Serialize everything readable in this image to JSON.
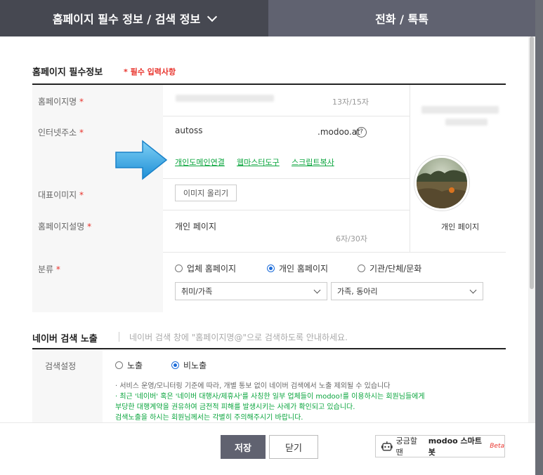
{
  "tabs": {
    "info_label": "홈페이지 필수 정보 / 검색 정보",
    "phone_label": "전화 / 톡톡"
  },
  "section1": {
    "title": "홈페이지 필수정보",
    "required_note": "* 필수 입력사항"
  },
  "rows": {
    "homepage_name": {
      "label": "홈페이지명",
      "count": "13자/15자"
    },
    "internet_address": {
      "label": "인터넷주소",
      "value": "autoss",
      "domain": ".modoo.at",
      "help": "?",
      "links": [
        "개인도메인연결",
        "웹마스터도구",
        "스크립트복사"
      ]
    },
    "rep_image": {
      "label": "대표이미지",
      "button": "이미지 올리기"
    },
    "description": {
      "label": "홈페이지설명",
      "value": "개인 페이지",
      "count": "6자/30자"
    },
    "category": {
      "label": "분류",
      "radios": [
        "업체 홈페이지",
        "개인 홈페이지",
        "기관/단체/문화"
      ],
      "selected_radio": 1,
      "select1": "취미/가족",
      "select2": "가족, 동아리"
    }
  },
  "required_star": "*",
  "preview": {
    "caption": "개인 페이지"
  },
  "section2": {
    "title": "네이버 검색 노출",
    "hint": "네이버 검색 창에 \"홈페이지명@\"으로 검색하도록 안내하세요.",
    "search_label": "검색설정",
    "radios": [
      "노출",
      "비노출"
    ],
    "selected_radio": 1,
    "notes": [
      "· 서비스 운영/모니터링 기준에 따라, 개별 통보 없이 네이버 검색에서 노출 제외될 수 있습니다",
      "· 최근 '네이버' 혹은 '네이버 대행사/제휴사'를 사칭한 일부 업체들이 modoo!를 이용하시는 회원님들에게",
      "  부당한 대행계약을 권유하여 금전적 피해를 발생시키는 사례가 확인되고 있습니다.",
      "  검색노출을 하시는 회원님께서는 각별히 주의해주시기 바랍니다."
    ]
  },
  "footer": {
    "save": "저장",
    "close": "닫기",
    "bot_prefix": "궁금할 땐",
    "bot_name": "modoo 스마트봇",
    "bot_beta": "Beta"
  },
  "colors": {
    "tab_active": "#464851",
    "tab_inactive": "#606270",
    "required": "#e8322b",
    "link": "#0aa53d",
    "radio": "#1b6bd9",
    "arrow": "#2da6e8"
  }
}
